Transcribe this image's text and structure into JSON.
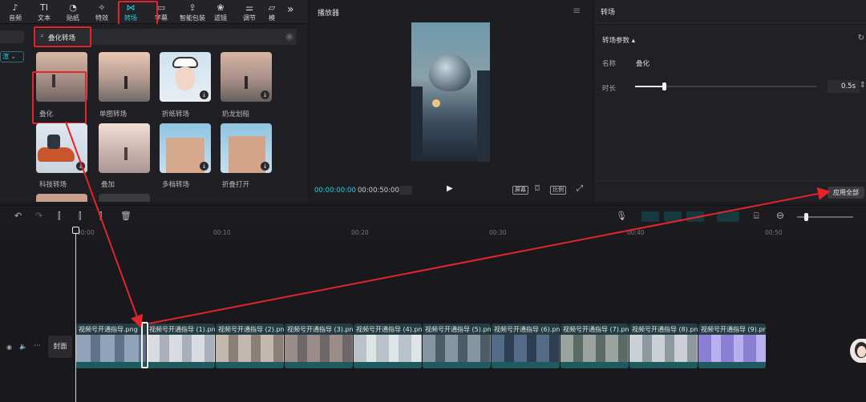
{
  "toolbar": {
    "tools": [
      {
        "label": "音频",
        "icon": "♪"
      },
      {
        "label": "文本",
        "icon": "TI"
      },
      {
        "label": "贴纸",
        "icon": "◔"
      },
      {
        "label": "特效",
        "icon": "✧"
      },
      {
        "label": "转场",
        "icon": "⋈"
      },
      {
        "label": "字幕",
        "icon": "▭"
      },
      {
        "label": "智能包装",
        "icon": "⇪"
      },
      {
        "label": "滤镜",
        "icon": "❀"
      },
      {
        "label": "调节",
        "icon": "⚌"
      },
      {
        "label": "模",
        "icon": "▱"
      }
    ],
    "more": "»"
  },
  "search": {
    "value": "叠化转场"
  },
  "left_filter": "渲",
  "library": {
    "items": [
      {
        "label": "叠化"
      },
      {
        "label": "单图转场"
      },
      {
        "label": "折纸转场"
      },
      {
        "label": "奶龙划船"
      },
      {
        "label": "科技转场"
      },
      {
        "label": "叠加"
      },
      {
        "label": "多档转场"
      },
      {
        "label": "折叠打开"
      }
    ]
  },
  "player": {
    "title": "播放器",
    "menu_icon": "≡",
    "time_current": "00:00:00:00",
    "time_total": "00:00:50:00",
    "btn_fullscreen_label": "屏幕",
    "btn_ratio_label": "比例"
  },
  "props": {
    "title": "转场",
    "section": "转场参数",
    "name_label": "名称",
    "name_value": "叠化",
    "duration_label": "时长",
    "duration_value": "0.5s",
    "duration_fraction": 0.16,
    "apply_all": "应用全部"
  },
  "timeline": {
    "ruler": [
      "00:00",
      "00:10",
      "00:20",
      "00:30",
      "00:40",
      "00:50"
    ],
    "cover_label": "封面",
    "clips": [
      "视频号开通指导.png",
      "视频号开通指导 (1).png",
      "视频号开通指导 (2).png",
      "视频号开通指导 (3).png",
      "视频号开通指导 (4).png",
      "视频号开通指导 (5).png",
      "视频号开通指导 (6).png",
      "视频号开通指导 (7).png",
      "视频号开通指导 (8).png",
      "视频号开通指导 (9).png"
    ]
  },
  "colors": {
    "accent": "#1fd1e0",
    "annotation_red": "#e3242b",
    "clip_bg": "#233d43"
  }
}
